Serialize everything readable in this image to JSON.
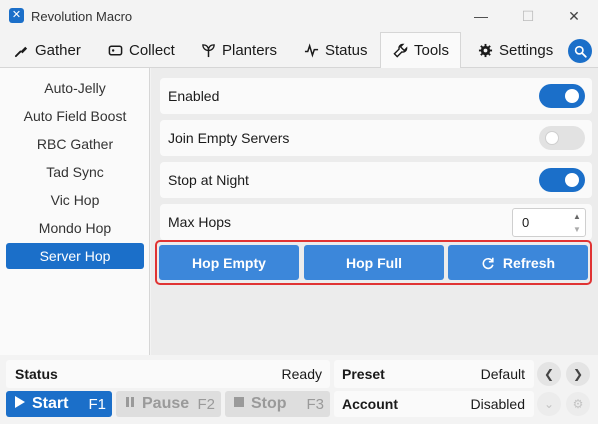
{
  "window": {
    "title": "Revolution Macro",
    "minimize": "—",
    "maximize": "☐",
    "close": "✕"
  },
  "tabs": [
    {
      "label": "Gather",
      "icon": "shovel-icon"
    },
    {
      "label": "Collect",
      "icon": "ticket-icon"
    },
    {
      "label": "Planters",
      "icon": "sprout-icon"
    },
    {
      "label": "Status",
      "icon": "pulse-icon"
    },
    {
      "label": "Tools",
      "icon": "wrench-icon",
      "active": true
    },
    {
      "label": "Settings",
      "icon": "gear-icon"
    }
  ],
  "sidebar": {
    "items": [
      {
        "label": "Auto-Jelly"
      },
      {
        "label": "Auto Field Boost"
      },
      {
        "label": "RBC Gather"
      },
      {
        "label": "Tad Sync"
      },
      {
        "label": "Vic Hop"
      },
      {
        "label": "Mondo Hop"
      },
      {
        "label": "Server Hop",
        "active": true
      }
    ]
  },
  "server_hop": {
    "enabled": {
      "label": "Enabled",
      "value": true
    },
    "join_empty": {
      "label": "Join Empty Servers",
      "value": false
    },
    "stop_night": {
      "label": "Stop at Night",
      "value": true
    },
    "max_hops": {
      "label": "Max Hops",
      "value": "0"
    },
    "buttons": {
      "hop_empty": "Hop Empty",
      "hop_full": "Hop Full",
      "refresh": "Refresh"
    }
  },
  "bottom": {
    "status_label": "Status",
    "status_value": "Ready",
    "start_label": "Start",
    "start_key": "F1",
    "pause_label": "Pause",
    "pause_key": "F2",
    "stop_label": "Stop",
    "stop_key": "F3",
    "preset_label": "Preset",
    "preset_value": "Default",
    "account_label": "Account",
    "account_value": "Disabled"
  },
  "colors": {
    "accent": "#1b6fc9",
    "button": "#3c87da",
    "highlight_border": "#e03333"
  }
}
